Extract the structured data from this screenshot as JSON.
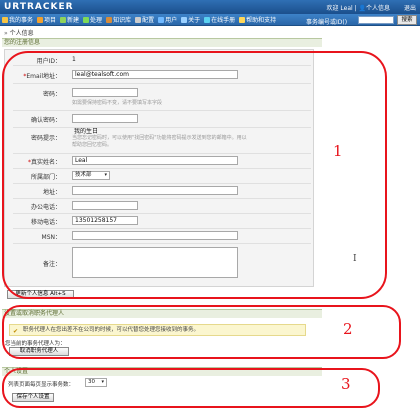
{
  "app": {
    "logo": "URTRACKER",
    "welcome": "欢迎 Leal | 👤个人信息",
    "exit": "退出"
  },
  "nav": {
    "items": [
      {
        "label": "我的事务",
        "icon": "house-icon",
        "color": "#f6c343"
      },
      {
        "label": "项目",
        "icon": "folder-icon",
        "color": "#f0a030"
      },
      {
        "label": "新建",
        "icon": "new-icon",
        "color": "#8fd35b"
      },
      {
        "label": "处理",
        "icon": "check-icon",
        "color": "#7ed957"
      },
      {
        "label": "知识库",
        "icon": "book-icon",
        "color": "#d58b3a"
      },
      {
        "label": "配置",
        "icon": "gear-icon",
        "color": "#cccccc"
      },
      {
        "label": "用户",
        "icon": "users-icon",
        "color": "#6fb8ff"
      },
      {
        "label": "关于",
        "icon": "info-icon",
        "color": "#9ad0ff"
      },
      {
        "label": "在线手册",
        "icon": "manual-icon",
        "color": "#5ad1f0"
      },
      {
        "label": "帮助和支持",
        "icon": "help-icon",
        "color": "#ffd75a"
      }
    ],
    "search_label": "事务编号或ID()",
    "search_value": "",
    "search_button": "搜索"
  },
  "breadcrumb": "个人信息",
  "section1": {
    "title": "您的注册信息",
    "fields": {
      "user_id_label": "用户ID：",
      "user_id_value": "1",
      "email_label": "Email地址：",
      "email_value": "leal@tealsoft.com",
      "password_label": "密码：",
      "password_value": "",
      "password_hint": "如需要保持密码不变，请不要填写本字段",
      "confirm_label": "确认密码：",
      "confirm_value": "",
      "pw_hint_label": "密码提示：",
      "pw_hint_value": "我的生日",
      "pw_hint_desc": "当您忘记密码时，可以使用\"找回密码\"功能将密码提示发送到您的邮箱中。用以帮助您回忆密码。",
      "realname_label": "真实姓名：",
      "realname_value": "Leal",
      "dept_label": "所属部门：",
      "dept_value": "技术部",
      "address_label": "地址：",
      "address_value": "",
      "office_label": "办公电话：",
      "office_value": "",
      "mobile_label": "移动电话：",
      "mobile_value": "13501258157",
      "msn_label": "MSN：",
      "msn_value": "",
      "notes_label": "备注：",
      "notes_value": ""
    },
    "save_button": "更新个人信息 Alt+S"
  },
  "section2": {
    "title": "设置或取消职务代理人",
    "notice": "职务代理人在您出差不在公司的时候，可以代替您处理您接收到的事务。",
    "current_label": "您当前的事务代理人为：",
    "cancel_button": "取消职务代理人"
  },
  "section3": {
    "title": "个人设置",
    "rows_label": "列表页面每页显示事务数：",
    "rows_value": "30",
    "save_button": "保存个人设置"
  },
  "annotations": {
    "one": "1",
    "two": "2",
    "three": "3"
  },
  "colors": {
    "brand": "#2a66a8",
    "annotation": "#e8141c",
    "section_header": "#e9efe0"
  }
}
